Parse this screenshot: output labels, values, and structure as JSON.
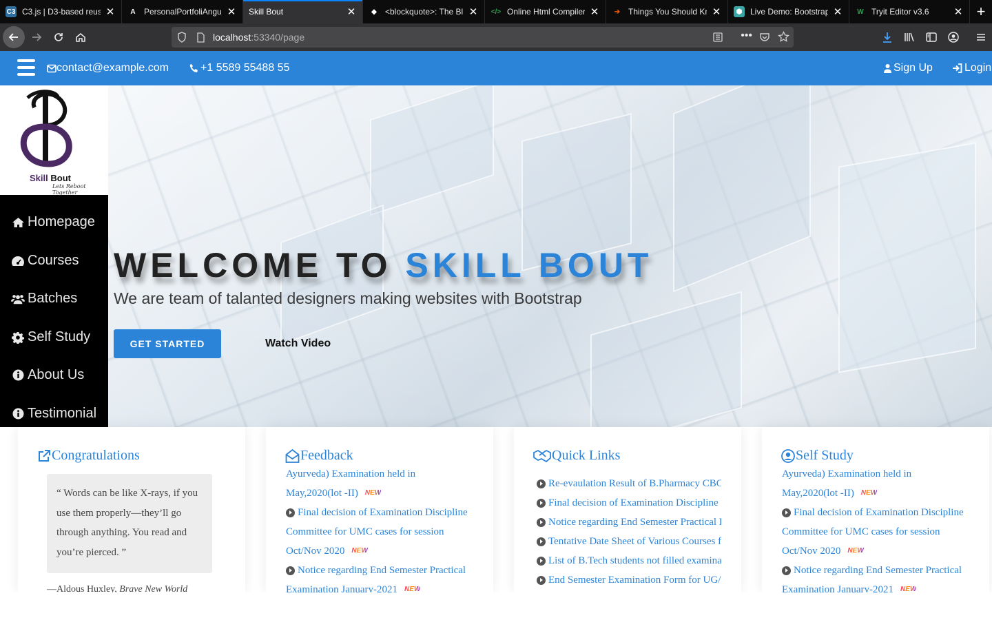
{
  "browser": {
    "tabs": [
      {
        "title": "C3.js | D3-based reus",
        "icon": "c3-icon",
        "color": "#2f6fa0",
        "active": false
      },
      {
        "title": "PersonalPortfoliAngul",
        "icon": "angular-a-icon",
        "color": "#222222",
        "active": false
      },
      {
        "title": "Skill Bout",
        "icon": "",
        "color": "",
        "active": true
      },
      {
        "title": "<blockquote>: The Bl",
        "icon": "mdn-icon",
        "color": "#111111",
        "active": false
      },
      {
        "title": "Online Html Compiler",
        "icon": "code-icon",
        "color": "#1e7a3c",
        "active": false
      },
      {
        "title": "Things You Should Kn",
        "icon": "arrow-icon",
        "color": "#e8590c",
        "active": false
      },
      {
        "title": "Live Demo: Bootstrap",
        "icon": "bootstrap-icon",
        "color": "#3aa6a6",
        "active": false
      },
      {
        "title": "Tryit Editor v3.6",
        "icon": "w3-icon",
        "color": "#2e9e4f",
        "active": false
      }
    ],
    "url_host": "localhost",
    "url_path": ":53340/page"
  },
  "topbar": {
    "email": "contact@example.com",
    "phone": "+1 5589 55488 55",
    "signup": "Sign Up",
    "login": "Login"
  },
  "logo": {
    "name_part1": "Skill",
    "name_part2": " Bout",
    "tagline": "Lets Reboot Together"
  },
  "sidebar": {
    "items": [
      {
        "label": "Homepage",
        "icon": "home-icon"
      },
      {
        "label": "Courses",
        "icon": "dashboard-icon"
      },
      {
        "label": "Batches",
        "icon": "users-icon"
      },
      {
        "label": "Self Study",
        "icon": "gear-icon"
      },
      {
        "label": "About Us",
        "icon": "info-icon"
      },
      {
        "label": "Testimonial",
        "icon": "info-icon"
      }
    ]
  },
  "hero": {
    "title_part1": "WELCOME TO ",
    "title_part2": "SKILL BOUT",
    "subtitle": "We are team of talanted designers making websites with Bootstrap",
    "cta": "GET STARTED",
    "watch": "Watch Video"
  },
  "cards": {
    "congrats": {
      "title": "Congratulations",
      "quote": "“ Words can be like X-rays, if you use them properly—they’ll go through anything. You read and you’re pierced. ”",
      "author": "—Aldous Huxley,",
      "work": "Brave New World"
    },
    "feedback": {
      "title": "Feedback",
      "lines": [
        {
          "text": "Ayurveda) Examination held in",
          "arrow": false,
          "new": false
        },
        {
          "text": "May,2020(lot -II)",
          "arrow": false,
          "new": true
        },
        {
          "text": "Final decision of Examination Discipline",
          "arrow": true,
          "new": false
        },
        {
          "text": "Committee for UMC cases for session",
          "arrow": false,
          "new": false
        },
        {
          "text": "Oct/Nov 2020",
          "arrow": false,
          "new": true
        },
        {
          "text": "Notice regarding End Semester Practical",
          "arrow": true,
          "new": false
        },
        {
          "text": "Examination January-2021",
          "arrow": false,
          "new": true
        }
      ]
    },
    "quicklinks": {
      "title": "Quick Links",
      "items": [
        "Re-evaulation Result of B.Pharmacy CBCS",
        "Final decision of Examination Discipline Committee",
        "Notice regarding End Semester Practical Examination",
        "Tentative Date Sheet of Various Courses for",
        "List of B.Tech students not filled examination",
        "End Semester Examination Form for UG/PG"
      ]
    },
    "selfstudy": {
      "title": "Self Study",
      "lines": [
        {
          "text": "Ayurveda) Examination held in",
          "arrow": false,
          "new": false
        },
        {
          "text": "May,2020(lot -II)",
          "arrow": false,
          "new": true
        },
        {
          "text": "Final decision of Examination Discipline",
          "arrow": true,
          "new": false
        },
        {
          "text": "Committee for UMC cases for session",
          "arrow": false,
          "new": false
        },
        {
          "text": "Oct/Nov 2020",
          "arrow": false,
          "new": true
        },
        {
          "text": "Notice regarding End Semester Practical",
          "arrow": true,
          "new": false
        },
        {
          "text": "Examination January-2021",
          "arrow": false,
          "new": true
        }
      ]
    },
    "new_label": "NEW"
  },
  "colors": {
    "brand": "#2c84d8",
    "sidebar": "#000000",
    "logo_purple": "#4b2a63"
  }
}
